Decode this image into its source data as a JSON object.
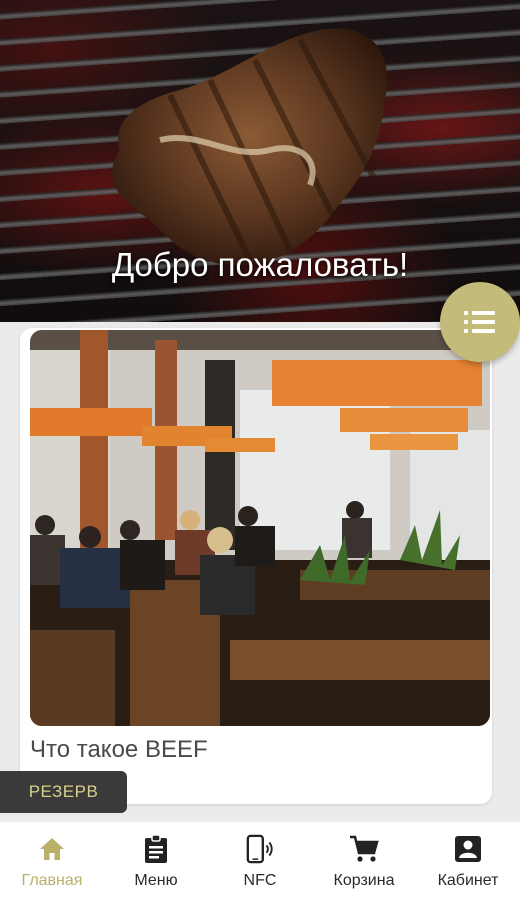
{
  "hero": {
    "title": "Добро пожаловать!"
  },
  "fab": {
    "icon": "list-icon",
    "color": "#c3bb7a"
  },
  "card": {
    "title": "Что такое BEEF"
  },
  "reserve": {
    "label": "РЕЗЕРВ"
  },
  "nav": {
    "active_color": "#b9b06a",
    "items": [
      {
        "label": "Главная",
        "icon": "home-icon",
        "active": true
      },
      {
        "label": "Меню",
        "icon": "clipboard-icon",
        "active": false
      },
      {
        "label": "NFC",
        "icon": "nfc-phone-icon",
        "active": false
      },
      {
        "label": "Корзина",
        "icon": "cart-icon",
        "active": false
      },
      {
        "label": "Кабинет",
        "icon": "account-icon",
        "active": false
      }
    ]
  }
}
